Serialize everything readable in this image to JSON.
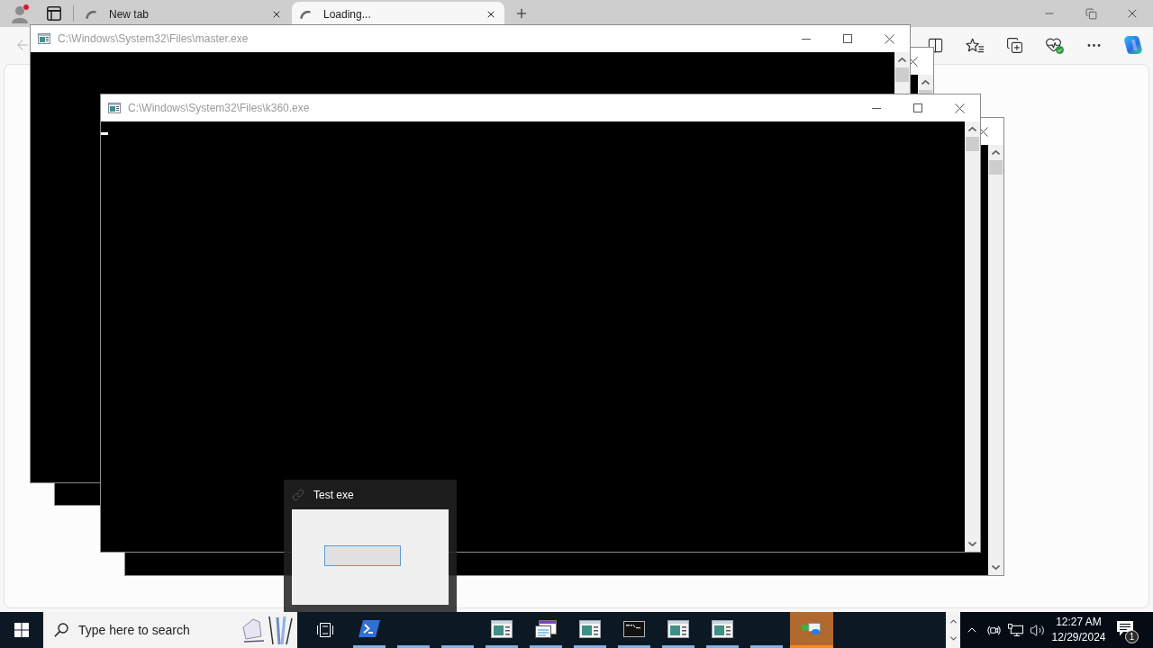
{
  "browser": {
    "tabs": [
      {
        "label": "New tab",
        "selected": false
      },
      {
        "label": "Loading...",
        "selected": true
      }
    ]
  },
  "windows": [
    {
      "title": "C:\\Windows\\System32\\Files\\master.exe",
      "active": false,
      "cursor": false
    },
    {
      "title": "C:\\Windows\\System32\\Files\\k360.exe",
      "active": false,
      "cursor": true
    }
  ],
  "thumbnail": {
    "title": "Test exe"
  },
  "taskbar": {
    "search": {
      "placeholder": "Type here to search"
    },
    "apps": [
      {
        "kind": "prompt",
        "running": true,
        "selected": false
      },
      {
        "kind": "empty",
        "running": true,
        "selected": false
      },
      {
        "kind": "empty",
        "running": true,
        "selected": false
      },
      {
        "kind": "console",
        "running": true,
        "selected": false
      },
      {
        "kind": "document",
        "running": true,
        "selected": false
      },
      {
        "kind": "console",
        "running": true,
        "selected": false
      },
      {
        "kind": "cmd",
        "running": true,
        "selected": false
      },
      {
        "kind": "console",
        "running": true,
        "selected": false
      },
      {
        "kind": "console",
        "running": true,
        "selected": false
      },
      {
        "kind": "empty",
        "running": true,
        "selected": false
      },
      {
        "kind": "remote",
        "running": true,
        "selected": true
      }
    ],
    "clock": {
      "time": "12:27 AM",
      "date": "12/29/2024"
    },
    "notifications": {
      "count": "1"
    }
  }
}
